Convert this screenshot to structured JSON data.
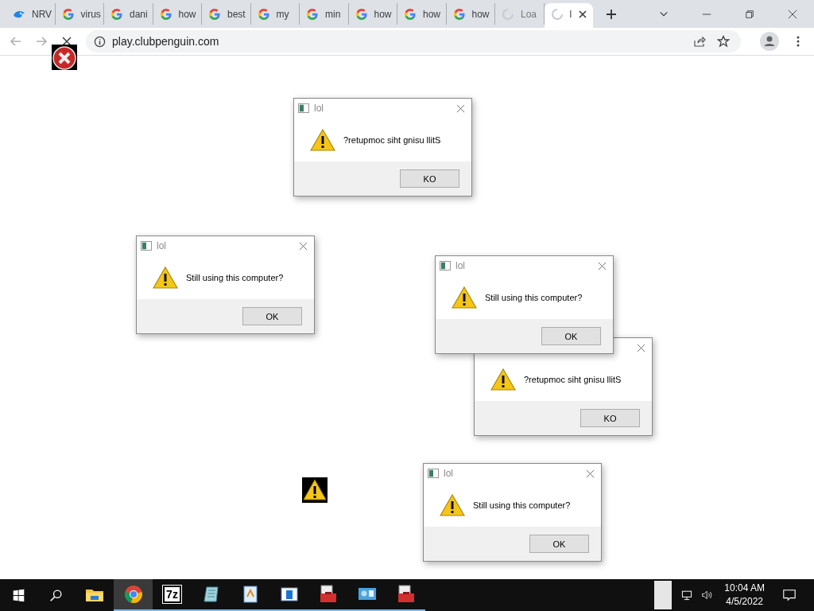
{
  "tabs": [
    {
      "label": "NRV",
      "kind": "nrv",
      "selected": false
    },
    {
      "label": "virus",
      "kind": "google",
      "selected": false
    },
    {
      "label": "dani",
      "kind": "google",
      "selected": false
    },
    {
      "label": "how",
      "kind": "google",
      "selected": false
    },
    {
      "label": "best",
      "kind": "google",
      "selected": false
    },
    {
      "label": "my",
      "kind": "google",
      "selected": false
    },
    {
      "label": "min",
      "kind": "google",
      "selected": false
    },
    {
      "label": "how",
      "kind": "google",
      "selected": false
    },
    {
      "label": "how",
      "kind": "google",
      "selected": false
    },
    {
      "label": "how",
      "kind": "google",
      "selected": false
    },
    {
      "label": "Loa",
      "kind": "loading",
      "selected": false
    },
    {
      "label": "l",
      "kind": "loading",
      "selected": true
    }
  ],
  "address_bar": {
    "url": "play.clubpenguin.com"
  },
  "dialogs": [
    {
      "title": "lol",
      "message": "?retupmoc siht gnisu llitS",
      "button": "KO"
    },
    {
      "title": "lol",
      "message": "Still using this computer?",
      "button": "OK"
    },
    {
      "message": "?retupmoc siht gnisu llitS",
      "button": "KO"
    },
    {
      "title": "lol",
      "message": "Still using this computer?",
      "button": "OK"
    },
    {
      "title": "lol",
      "message": "Still using this computer?",
      "button": "OK"
    }
  ],
  "taskbar": {
    "apps": [
      {
        "kind": "explorer",
        "selected": false,
        "running": false
      },
      {
        "kind": "chrome",
        "selected": true,
        "running": true
      },
      {
        "kind": "sevenzip",
        "label": "7z",
        "selected": false,
        "running": true
      },
      {
        "kind": "notepad",
        "selected": false,
        "running": true
      },
      {
        "kind": "wordpad",
        "selected": false,
        "running": true
      },
      {
        "kind": "window",
        "selected": false,
        "running": true
      },
      {
        "kind": "toolbox",
        "selected": false,
        "running": true
      },
      {
        "kind": "monitor",
        "selected": false,
        "running": true
      },
      {
        "kind": "toolbox",
        "selected": false,
        "running": true
      }
    ],
    "time": "10:04 AM",
    "date": "4/5/2022"
  }
}
